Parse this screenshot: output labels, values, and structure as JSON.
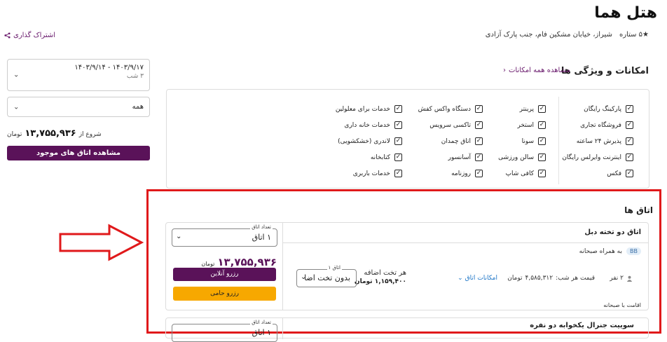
{
  "hotel": {
    "title": "هتل هما",
    "stars": "۵ ستاره",
    "address": "شیراز، خیابان مشکین فام، جنب پارک آزادی",
    "share": "اشتراک گذاری"
  },
  "amenities": {
    "heading": "امکانات و ویژگی ها",
    "view_all": "مشاهده همه امکانات",
    "columns": [
      [
        "پارکینگ رایگان",
        "فروشگاه تجاری",
        "پذیرش ۲۴ ساعته",
        "اینترنت وایرلس رایگان",
        "فکس"
      ],
      [
        "پرینتر",
        "استخر",
        "سونا",
        "سالن ورزشی",
        "کافی شاپ"
      ],
      [
        "دستگاه واکس کفش",
        "تاکسی سرویس",
        "اتاق چمدان",
        "آسانسور",
        "روزنامه"
      ],
      [
        "خدمات برای معلولین",
        "خدمات خانه داری",
        "لاندری (خشکشویی)",
        "کتابخانه",
        "خدمات باربری"
      ]
    ]
  },
  "sidebar": {
    "dates": "۱۴۰۳/۹/۱۴ - ۱۴۰۳/۹/۱۷",
    "nights": "۳ شب",
    "guests": "همه",
    "start_from": "شروع از",
    "start_price": "۱۳,۷۵۵,۹۳۶",
    "currency": "تومان",
    "cta": "مشاهده اتاق های موجود"
  },
  "rooms": {
    "heading": "اتاق ها",
    "items": [
      {
        "title": "اتاق دو تخته دبل",
        "board_badge": "BB",
        "board": "به همراه صبحانه",
        "people": "۲ نفر",
        "nightly_label": "قیمت هر شب:",
        "nightly_price": "۴,۵۸۵,۳۱۲",
        "currency": "تومان",
        "room_facilities": "امکانات اتاق",
        "extra_bed_label": "هر تخت اضافه",
        "extra_bed_price": "۱,۱۵۹,۴۰۰ تومان",
        "extra_bed_select_legend": "اتاق ۱",
        "extra_bed_select": "بدون تخت اضا",
        "stay_note": "اقامت با صبحانه",
        "count_legend": "تعداد اتاق",
        "count_value": "۱ اتاق",
        "total": "۱۳,۷۵۵,۹۳۶",
        "total_currency": "تومان",
        "reserve_online": "رزرو آنلاین",
        "reserve_hami": "رزرو حامی"
      },
      {
        "title": "سوییت جنرال یکخوابه دو نفره",
        "count_legend": "تعداد اتاق",
        "count_value": "۱ اتاق"
      }
    ]
  }
}
